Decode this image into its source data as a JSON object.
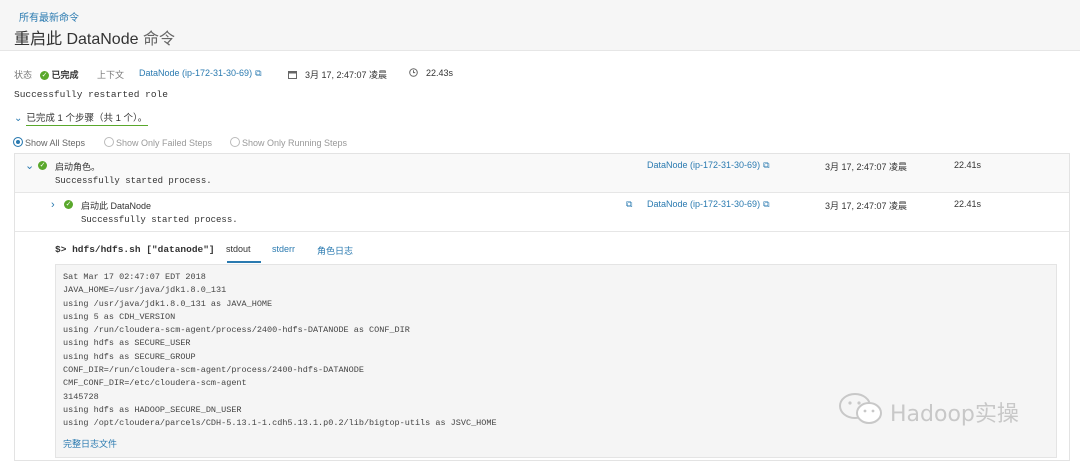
{
  "header": {
    "breadcrumb": "所有最新命令",
    "title_prefix": "重启此 DataNode",
    "title_suffix": "命令"
  },
  "meta": {
    "status_label": "状态",
    "status_value": "已完成",
    "context_label": "上下文",
    "context_link": "DataNode (ip-172-31-30-69)",
    "time": "3月 17, 2:47:07 凌晨",
    "duration": "22.43s"
  },
  "message": "Successfully restarted role",
  "steps_toggle": "已完成 1 个步骤（共 1 个）。",
  "filters": [
    {
      "label": "Show All Steps",
      "selected": true
    },
    {
      "label": "Show Only Failed Steps",
      "selected": false
    },
    {
      "label": "Show Only Running Steps",
      "selected": false
    }
  ],
  "steps": [
    {
      "title": "启动角色。",
      "detail": "Successfully started process.",
      "context": "DataNode (ip-172-31-30-69)",
      "time": "3月 17, 2:47:07 凌晨",
      "duration": "22.41s"
    },
    {
      "title": "启动此 DataNode",
      "detail": "Successfully started process.",
      "context": "DataNode (ip-172-31-30-69)",
      "time": "3月 17, 2:47:07 凌晨",
      "duration": "22.41s"
    }
  ],
  "command_line": "$> hdfs/hdfs.sh [\"datanode\"]",
  "tabs": [
    "stdout",
    "stderr",
    "角色日志"
  ],
  "log_lines": "Sat Mar 17 02:47:07 EDT 2018\nJAVA_HOME=/usr/java/jdk1.8.0_131\nusing /usr/java/jdk1.8.0_131 as JAVA_HOME\nusing 5 as CDH_VERSION\nusing /run/cloudera-scm-agent/process/2400-hdfs-DATANODE as CONF_DIR\nusing hdfs as SECURE_USER\nusing hdfs as SECURE_GROUP\nCONF_DIR=/run/cloudera-scm-agent/process/2400-hdfs-DATANODE\nCMF_CONF_DIR=/etc/cloudera-scm-agent\n3145728\nusing hdfs as HADOOP_SECURE_DN_USER\nusing /opt/cloudera/parcels/CDH-5.13.1-1.cdh5.13.1.p0.2/lib/bigtop-utils as JSVC_HOME",
  "full_log_link": "完整日志文件",
  "watermark": "Hadoop实操",
  "colors": {
    "link": "#2a7ab0",
    "success": "#5aa82c"
  }
}
